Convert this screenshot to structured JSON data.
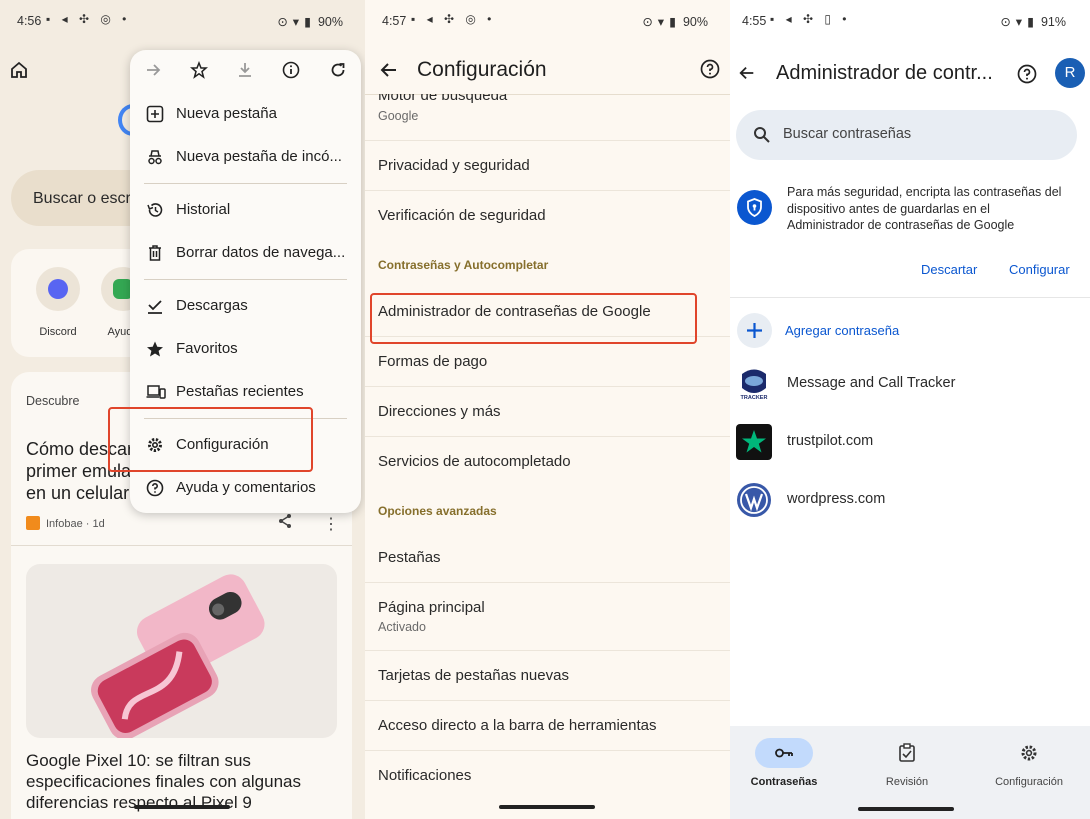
{
  "panel1": {
    "status": {
      "time": "4:56",
      "battery": "90%"
    },
    "search_text": "Buscar o escr",
    "shortcuts": [
      {
        "label": "Discord"
      },
      {
        "label": "Ayuda"
      }
    ],
    "feed_title": "Descubre",
    "article1": {
      "lines": [
        "Cómo descar",
        "primer emula",
        "en un celular"
      ],
      "source": "Infobae · 1d"
    },
    "article2_title": "Google Pixel 10: se filtran sus especificaciones finales con algunas diferencias respecto al Pixel 9",
    "menu": {
      "items": [
        {
          "label": "Nueva pestaña",
          "icon": "new-tab-icon"
        },
        {
          "label": "Nueva pestaña de incó...",
          "icon": "incognito-icon"
        },
        {
          "label": "Historial",
          "icon": "history-icon"
        },
        {
          "label": "Borrar datos de navega...",
          "icon": "trash-icon"
        },
        {
          "label": "Descargas",
          "icon": "download-check-icon"
        },
        {
          "label": "Favoritos",
          "icon": "star-icon"
        },
        {
          "label": "Pestañas recientes",
          "icon": "devices-icon"
        },
        {
          "label": "Configuración",
          "icon": "gear-icon"
        },
        {
          "label": "Ayuda y comentarios",
          "icon": "help-icon"
        }
      ]
    }
  },
  "panel2": {
    "status": {
      "time": "4:57",
      "battery": "90%"
    },
    "title": "Configuración",
    "rows": [
      {
        "title": "Motor de búsqueda",
        "subtitle": "Google"
      },
      {
        "title": "Privacidad y seguridad"
      },
      {
        "title": "Verificación de seguridad"
      },
      {
        "header": "Contraseñas y Autocompletar"
      },
      {
        "title": "Administrador de contraseñas de Google"
      },
      {
        "title": "Formas de pago"
      },
      {
        "title": "Direcciones y más"
      },
      {
        "title": "Servicios de autocompletado"
      },
      {
        "header": "Opciones avanzadas"
      },
      {
        "title": "Pestañas"
      },
      {
        "title": "Página principal",
        "subtitle": "Activado"
      },
      {
        "title": "Tarjetas de pestañas nuevas"
      },
      {
        "title": "Acceso directo a la barra de herramientas"
      },
      {
        "title": "Notificaciones"
      }
    ]
  },
  "panel3": {
    "status": {
      "time": "4:55",
      "battery": "91%"
    },
    "title": "Administrador de contr...",
    "avatar_letter": "R",
    "search_placeholder": "Buscar contraseñas",
    "encrypt_text": "Para más seguridad, encripta las contraseñas del dispositivo antes de guardarlas en el Administrador de contraseñas de Google",
    "dismiss": "Descartar",
    "configure": "Configurar",
    "add_password": "Agregar contraseña",
    "passwords": [
      {
        "site": "Message and Call Tracker",
        "logo_text": "TRACKER"
      },
      {
        "site": "trustpilot.com"
      },
      {
        "site": "wordpress.com"
      }
    ],
    "nav": [
      {
        "label": "Contraseñas",
        "icon": "key-icon",
        "active": true
      },
      {
        "label": "Revisión",
        "icon": "checkup-icon",
        "active": false
      },
      {
        "label": "Configuración",
        "icon": "gear-icon",
        "active": false
      }
    ]
  },
  "colors": {
    "highlight": "#e0452b",
    "google_blue": "#0b57d0",
    "section_header": "#866f2c"
  }
}
